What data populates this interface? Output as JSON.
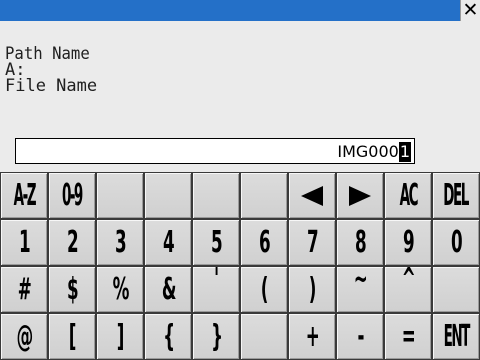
{
  "window": {
    "close_label": "✕"
  },
  "info": {
    "path_label": "Path Name",
    "drive": "A:",
    "file_label": "File Name"
  },
  "input": {
    "value": "IMG000",
    "cursor_char": "1"
  },
  "keyboard": {
    "rows": [
      [
        "A-Z",
        "0-9",
        "",
        "",
        "",
        "",
        "◀",
        "▶",
        "AC",
        "DEL"
      ],
      [
        "1",
        "2",
        "3",
        "4",
        "5",
        "6",
        "7",
        "8",
        "9",
        "0"
      ],
      [
        "#",
        "$",
        "%",
        "&",
        "'",
        "(",
        ")",
        "~",
        "^",
        ""
      ],
      [
        "@",
        "[",
        "]",
        "{",
        "}",
        "_",
        "+",
        "-",
        "=",
        "ENT"
      ]
    ]
  },
  "colors": {
    "titlebar": "#2470c8",
    "background": "#ebebeb",
    "key_face": "#d4d4d4"
  }
}
